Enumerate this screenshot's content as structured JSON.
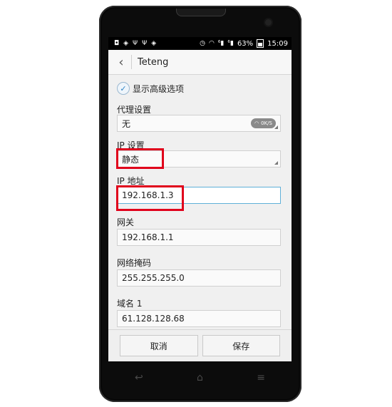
{
  "status_bar": {
    "signal_1": "⁶",
    "signal_2": "⁶",
    "battery_percent": "63%",
    "time": "15:09"
  },
  "action_bar": {
    "title": "Teteng"
  },
  "checkbox": {
    "label": "显示高级选项",
    "checked": true
  },
  "proxy": {
    "label": "代理设置",
    "value": "无",
    "net_speed": "0K/S"
  },
  "ip_settings": {
    "label": "IP 设置",
    "value": "静态"
  },
  "ip_address": {
    "label": "IP 地址",
    "value": "192.168.1.3"
  },
  "gateway": {
    "label": "网关",
    "value": "192.168.1.1"
  },
  "netmask": {
    "label": "网络掩码",
    "value": "255.255.255.0"
  },
  "dns1": {
    "label": "域名 1",
    "value": "61.128.128.68"
  },
  "buttons": {
    "cancel": "取消",
    "save": "保存"
  },
  "colors": {
    "highlight": "#e0001b",
    "active_border": "#5fb0d8"
  }
}
